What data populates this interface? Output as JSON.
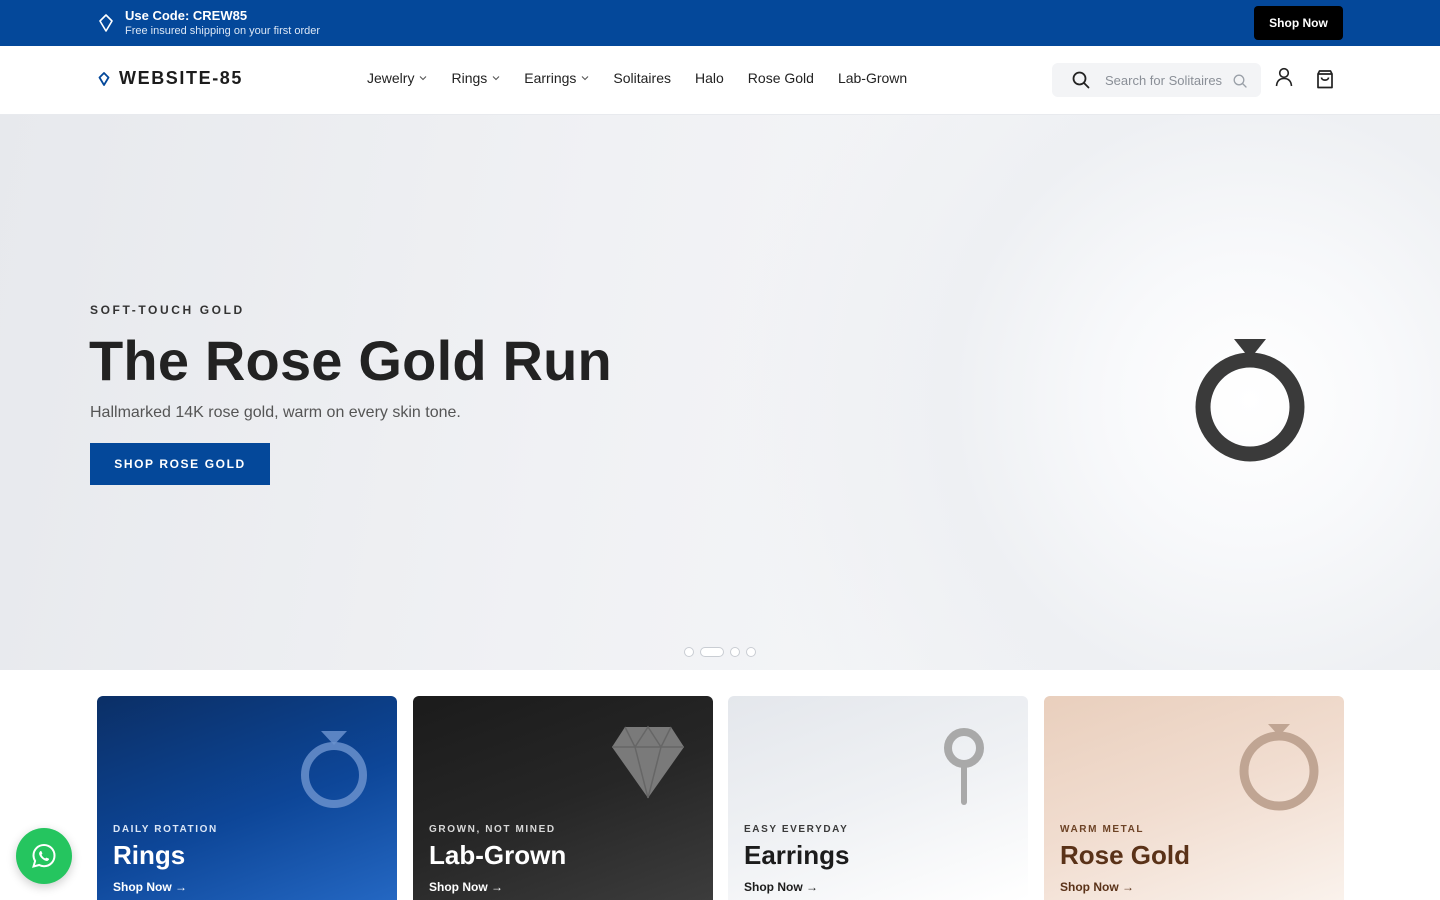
{
  "promo": {
    "code_text": "Use Code: CREW85",
    "subtitle": "Free insured shipping on your first order",
    "button_label": "Shop Now",
    "background_color": "#04489a"
  },
  "header": {
    "logo_text": "WEBSITE-85",
    "logo_icon": "diamond-icon",
    "nav": [
      {
        "label": "Jewelry",
        "has_dropdown": true
      },
      {
        "label": "Rings",
        "has_dropdown": true
      },
      {
        "label": "Earrings",
        "has_dropdown": true
      },
      {
        "label": "Solitaires",
        "has_dropdown": false
      },
      {
        "label": "Halo",
        "has_dropdown": false
      },
      {
        "label": "Rose Gold",
        "has_dropdown": false
      },
      {
        "label": "Lab-Grown",
        "has_dropdown": false
      }
    ],
    "search": {
      "placeholder": "Search for Solitaires",
      "value": ""
    },
    "icons": [
      "search-icon",
      "account-icon",
      "cart-icon"
    ]
  },
  "hero": {
    "eyebrow": "SOFT-TOUCH GOLD",
    "title": "The Rose Gold Run",
    "description": "Hallmarked 14K rose gold, warm on every skin tone.",
    "cta_label": "SHOP ROSE GOLD",
    "image_icon": "ring-icon",
    "slides_total": 4,
    "active_slide": 2
  },
  "categories": [
    {
      "kicker": "DAILY ROTATION",
      "title": "Rings",
      "link": "Shop Now →",
      "icon": "ring-icon"
    },
    {
      "kicker": "GROWN, NOT MINED",
      "title": "Lab-Grown",
      "link": "Shop Now →",
      "icon": "gem-icon"
    },
    {
      "kicker": "EASY EVERYDAY",
      "title": "Earrings",
      "link": "Shop Now →",
      "icon": "earring-icon"
    },
    {
      "kicker": "WARM METAL",
      "title": "Rose Gold",
      "link": "Shop Now →",
      "icon": "ring-icon"
    }
  ],
  "chat_widget": {
    "icon": "whatsapp-icon",
    "color": "#25c55f"
  }
}
